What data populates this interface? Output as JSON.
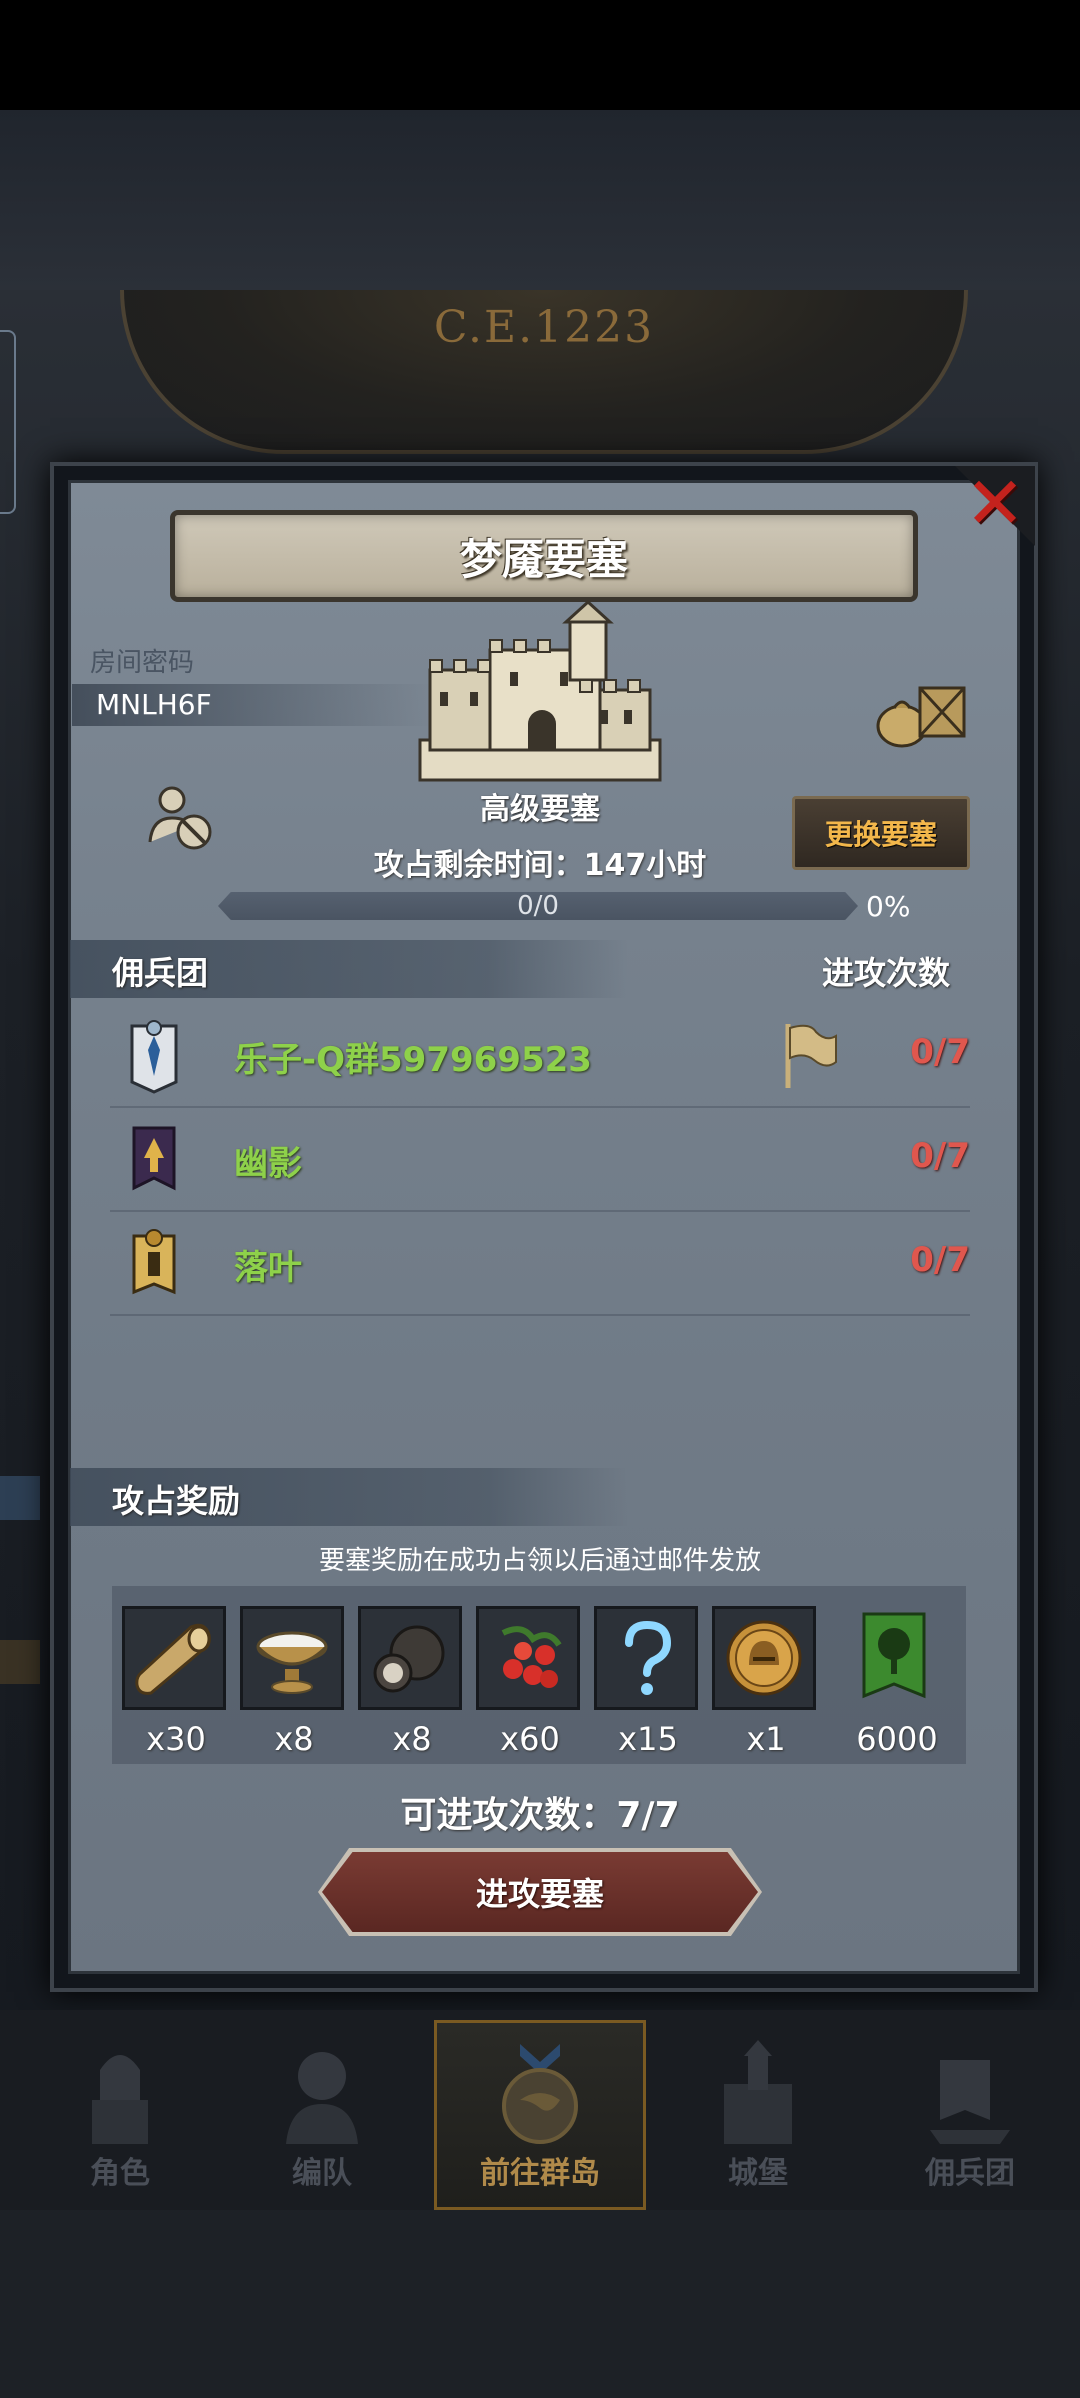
{
  "header": {
    "era": "C.E.1223"
  },
  "dialog": {
    "title": "梦魇要塞",
    "room": {
      "label": "房间密码",
      "code": "MNLH6F"
    },
    "fortress_type": "高级要塞",
    "change_button": "更换要塞",
    "remaining_time": "攻占剩余时间：147小时",
    "progress": {
      "text": "0/0",
      "percent_label": "0%",
      "value": 0
    },
    "guild_section": {
      "title": "佣兵团",
      "count_header": "进攻次数"
    },
    "guilds": [
      {
        "name": "乐子-Q群597969523",
        "count": "0/7",
        "has_flag": true
      },
      {
        "name": "幽影",
        "count": "0/7",
        "has_flag": false
      },
      {
        "name": "落叶",
        "count": "0/7",
        "has_flag": false
      }
    ],
    "reward_section": {
      "title": "攻占奖励",
      "note": "要塞奖励在成功占领以后通过邮件发放"
    },
    "rewards": [
      {
        "icon": "wood-log-icon",
        "qty": "x30"
      },
      {
        "icon": "bowl-icon",
        "qty": "x8"
      },
      {
        "icon": "truffle-icon",
        "qty": "x8"
      },
      {
        "icon": "berries-icon",
        "qty": "x60"
      },
      {
        "icon": "question-mark-icon",
        "qty": "x15"
      },
      {
        "icon": "helmet-coin-icon",
        "qty": "x1"
      },
      {
        "icon": "tree-banner-icon",
        "qty": "6000"
      }
    ],
    "attacks_available": "可进攻次数：7/7",
    "attack_button": "进攻要塞"
  },
  "nav": [
    {
      "label": "角色",
      "icon": "knight-icon"
    },
    {
      "label": "编队",
      "icon": "formation-icon"
    },
    {
      "label": "前往群岛",
      "icon": "compass-globe-icon",
      "active": true
    },
    {
      "label": "城堡",
      "icon": "castle-icon"
    },
    {
      "label": "佣兵团",
      "icon": "guild-ship-icon"
    }
  ],
  "colors": {
    "guild_name": "#8ed14a",
    "attack_count": "#e0574e",
    "accent_gold": "#f3b74b",
    "close": "#c4221d"
  }
}
